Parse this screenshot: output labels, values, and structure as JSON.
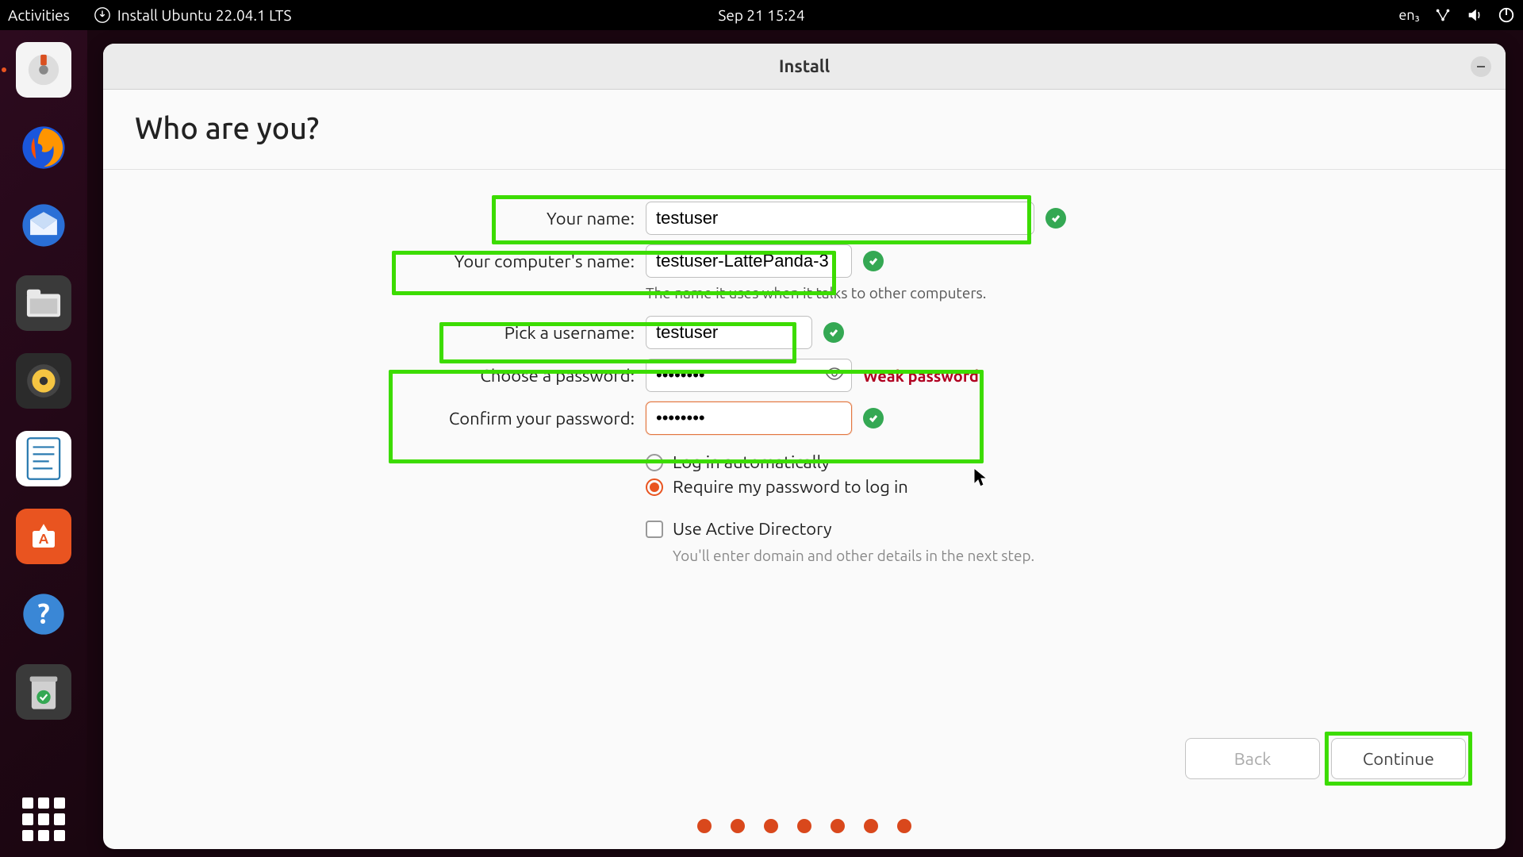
{
  "topbar": {
    "activities": "Activities",
    "app_title": "Install Ubuntu 22.04.1 LTS",
    "clock": "Sep 21  15:24",
    "lang": "en₃"
  },
  "window": {
    "title": "Install",
    "heading": "Who are you?"
  },
  "form": {
    "name_label": "Your name:",
    "name_value": "testuser",
    "computer_label": "Your computer's name:",
    "computer_value": "testuser-LattePanda-3",
    "computer_hint": "The name it uses when it talks to other computers.",
    "username_label": "Pick a username:",
    "username_value": "testuser",
    "password_label": "Choose a password:",
    "password_value": "••••••••",
    "password_strength": "Weak password",
    "confirm_label": "Confirm your password:",
    "confirm_value": "••••••••",
    "login_auto": "Log in automatically",
    "login_pw": "Require my password to log in",
    "use_ad": "Use Active Directory",
    "ad_hint": "You'll enter domain and other details in the next step."
  },
  "buttons": {
    "back": "Back",
    "continue": "Continue"
  }
}
